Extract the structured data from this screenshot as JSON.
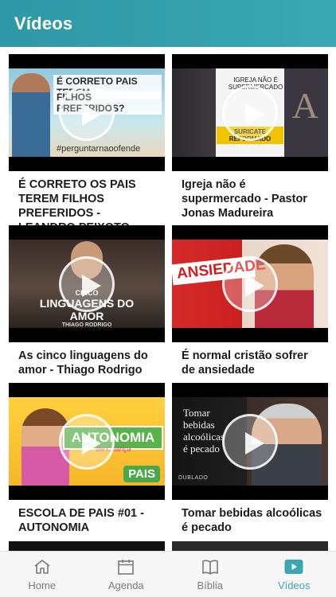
{
  "header": {
    "title": "Vídeos"
  },
  "videos": [
    {
      "title": "É CORRETO OS PAIS TEREM FILHOS PREFERIDOS - LEANDRO PEIXOTO",
      "thumb_line1": "É CORRETO PAIS TEREM",
      "thumb_line2": "FILHOS PREFERIDOS?",
      "thumb_hashtag": "#perguntarnaoofende"
    },
    {
      "title": "Igreja não é supermercado - Pastor Jonas Madureira",
      "thumb_caption": "IGREJA NÃO É SUPERMERCADO",
      "thumb_banner": "SURICATE REFORMADO"
    },
    {
      "title": "As cinco linguagens do amor - Thiago Rodrigo",
      "thumb_line1": "CINCO",
      "thumb_line2": "LINGUAGENS DO AMOR",
      "thumb_line3": "THIAGO RODRIGO"
    },
    {
      "title": "É normal cristão sofrer de ansiedade",
      "thumb_word": "ANSIEDADE"
    },
    {
      "title": "ESCOLA DE PAIS #01 - AUTONOMIA",
      "thumb_banner": "AUTONOMIA",
      "thumb_sub": "da Criança",
      "thumb_badge": "PAIS"
    },
    {
      "title": "Tomar bebidas alcoólicas é pecado",
      "thumb_quote_1": "Tomar",
      "thumb_quote_2": "bebidas",
      "thumb_quote_3": "alcoólicas",
      "thumb_quote_4": "é pecado",
      "thumb_tag": "DUBLADO"
    }
  ],
  "nav": [
    {
      "label": "Home",
      "icon": "home-icon",
      "active": false
    },
    {
      "label": "Agenda",
      "icon": "calendar-icon",
      "active": false
    },
    {
      "label": "Bíblia",
      "icon": "book-icon",
      "active": false
    },
    {
      "label": "Vídeos",
      "icon": "play-icon",
      "active": true
    }
  ],
  "colors": {
    "primary": "#3aa7b2",
    "inactive": "#7a7a7a"
  }
}
